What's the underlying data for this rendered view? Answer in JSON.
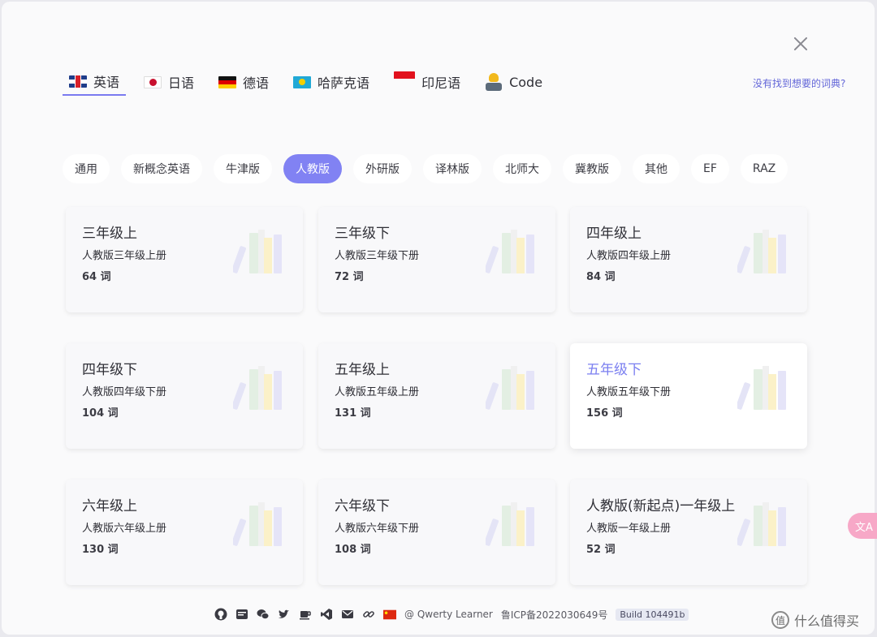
{
  "languages": [
    {
      "label": "英语",
      "flag": "flag-uk"
    },
    {
      "label": "日语",
      "flag": "flag-jp"
    },
    {
      "label": "德语",
      "flag": "flag-de"
    },
    {
      "label": "哈萨克语",
      "flag": "flag-kz"
    },
    {
      "label": "印尼语",
      "flag": "flag-id"
    },
    {
      "label": "Code",
      "flag": "coder-icon"
    }
  ],
  "active_language": "英语",
  "not_found_link": "没有找到想要的词典?",
  "categories": [
    "通用",
    "新概念英语",
    "牛津版",
    "人教版",
    "外研版",
    "译林版",
    "北师大",
    "冀教版",
    "其他",
    "EF",
    "RAZ"
  ],
  "active_category": "人教版",
  "cards": [
    {
      "title": "三年级上",
      "desc": "人教版三年级上册",
      "count": "64 词"
    },
    {
      "title": "三年级下",
      "desc": "人教版三年级下册",
      "count": "72 词"
    },
    {
      "title": "四年级上",
      "desc": "人教版四年级上册",
      "count": "84 词"
    },
    {
      "title": "四年级下",
      "desc": "人教版四年级下册",
      "count": "104 词"
    },
    {
      "title": "五年级上",
      "desc": "人教版五年级上册",
      "count": "131 词"
    },
    {
      "title": "五年级下",
      "desc": "人教版五年级下册",
      "count": "156 词"
    },
    {
      "title": "六年级上",
      "desc": "人教版六年级上册",
      "count": "130 词"
    },
    {
      "title": "六年级下",
      "desc": "人教版六年级下册",
      "count": "108 词"
    },
    {
      "title": "人教版(新起点)一年级上",
      "desc": "人教版一年级上册",
      "count": "52 词"
    }
  ],
  "selected_card": "五年级下",
  "footer": {
    "icons": [
      "github-icon",
      "mp-icon",
      "wechat-icon",
      "twitter-icon",
      "coffee-icon",
      "vscode-icon",
      "mail-icon",
      "link-icon",
      "china-flag-icon"
    ],
    "author": "@ Qwerty Learner",
    "icp": "鲁ICP备2022030649号",
    "build": "Build 104491b"
  },
  "side_float_label": "文A",
  "watermark": "什么值得买",
  "colors": {
    "accent": "#8182f3",
    "link": "#6366d8",
    "selected_title": "#7b7ff0"
  }
}
